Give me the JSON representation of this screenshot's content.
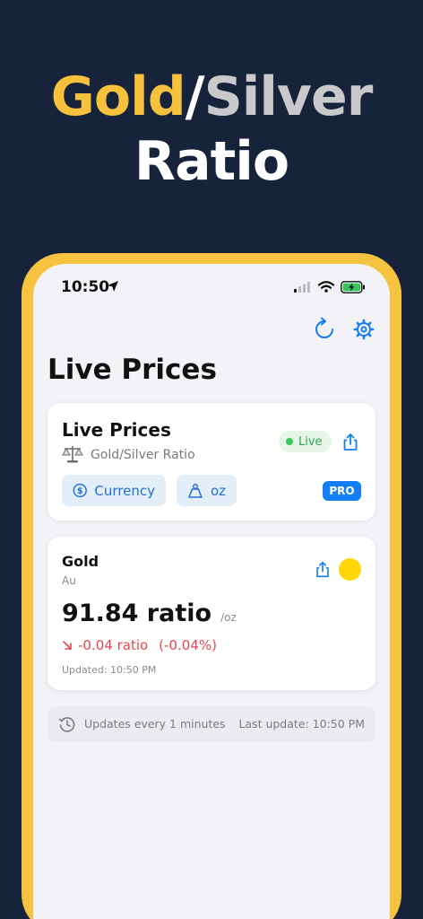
{
  "headline": {
    "gold": "Gold",
    "slash": "/",
    "silver": "Silver",
    "line2": "Ratio"
  },
  "status_bar": {
    "time": "10:50",
    "icons": [
      "location-arrow-icon",
      "cellular-signal-icon",
      "wifi-icon",
      "battery-charging-icon"
    ]
  },
  "toolbar": {
    "icons": [
      "refresh-icon",
      "gear-icon"
    ]
  },
  "page_title": "Live Prices",
  "live_card": {
    "title": "Live Prices",
    "subtitle": "Gold/Silver Ratio",
    "badge": "Live",
    "currency_chip": "Currency",
    "unit_chip": "oz",
    "pro_badge": "PRO"
  },
  "gold_card": {
    "name": "Gold",
    "symbol": "Au",
    "price": "91.84 ratio",
    "unit": "/oz",
    "change": "-0.04 ratio",
    "change_pct": "(-0.04%)",
    "updated": "Updated: 10:50 PM"
  },
  "footer": {
    "interval": "Updates every 1 minutes",
    "last_update": "Last update: 10:50 PM"
  },
  "colors": {
    "background": "#17233a",
    "gold_accent": "#f6c23e",
    "accent_blue": "#147ef5",
    "live_green": "#34c759",
    "negative_red": "#e5484d",
    "gold_dot": "#ffd60a"
  }
}
